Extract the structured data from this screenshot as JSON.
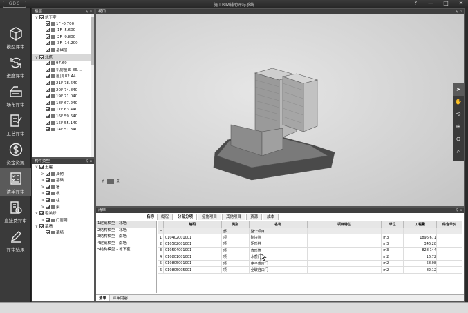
{
  "app": {
    "logo": "GDC",
    "title": "施工BIM辅助评标系统",
    "win_help": "?",
    "win_min": "—",
    "win_max": "□",
    "win_close": "✕"
  },
  "nav": [
    {
      "label": "模型评审",
      "icon": "cube-icon"
    },
    {
      "label": "进度评审",
      "icon": "progress-icon"
    },
    {
      "label": "场布评审",
      "icon": "site-layout-icon"
    },
    {
      "label": "工艺评审",
      "icon": "edit-doc-icon"
    },
    {
      "label": "资金资源",
      "icon": "dollar-icon"
    },
    {
      "label": "清单评审",
      "icon": "checklist-icon"
    },
    {
      "label": "直接费评审",
      "icon": "cost-doc-icon"
    },
    {
      "label": "评审结果",
      "icon": "pen-icon"
    }
  ],
  "floors_panel": {
    "title": "楼层",
    "items": [
      {
        "label": "地下室",
        "level": 0,
        "expand": "∨"
      },
      {
        "label": "1F -0.700",
        "level": 1
      },
      {
        "label": "-1F -5.600",
        "level": 1
      },
      {
        "label": "-2F -9.800",
        "level": 1
      },
      {
        "label": "-3F -14.200",
        "level": 1
      },
      {
        "label": "基础层",
        "level": 1
      },
      {
        "label": "北塔",
        "level": 0,
        "expand": "∨",
        "selected": true
      },
      {
        "label": "97.69",
        "level": 1
      },
      {
        "label": "机房屋面 86....",
        "level": 1
      },
      {
        "label": "屋顶 82.44",
        "level": 1
      },
      {
        "label": "21F 78.640",
        "level": 1
      },
      {
        "label": "20F 74.840",
        "level": 1
      },
      {
        "label": "19F 71.040",
        "level": 1
      },
      {
        "label": "18F 67.240",
        "level": 1
      },
      {
        "label": "17F 63.440",
        "level": 1
      },
      {
        "label": "16F 59.640",
        "level": 1
      },
      {
        "label": "15F 55.140",
        "level": 1
      },
      {
        "label": "14F 51.340",
        "level": 1
      }
    ]
  },
  "components_panel": {
    "title": "构件类型",
    "items": [
      {
        "label": "土建",
        "level": 0,
        "expand": "∨"
      },
      {
        "label": "其他",
        "level": 1,
        "expand": ">"
      },
      {
        "label": "基础",
        "level": 1,
        "expand": ">"
      },
      {
        "label": "墙",
        "level": 1,
        "expand": ">"
      },
      {
        "label": "板",
        "level": 1,
        "expand": ">"
      },
      {
        "label": "柱",
        "level": 1,
        "expand": ">"
      },
      {
        "label": "梁",
        "level": 1,
        "expand": ">"
      },
      {
        "label": "粗装修",
        "level": 0,
        "expand": "∨"
      },
      {
        "label": "门窗洞",
        "level": 1,
        "expand": ">"
      },
      {
        "label": "幕墙",
        "level": 0,
        "expand": "∨"
      },
      {
        "label": "幕墙",
        "level": 1,
        "expand": ""
      }
    ]
  },
  "viewport": {
    "title": "视口",
    "axis_y": "Y",
    "axis_x": "X"
  },
  "list_panel": {
    "title": "清单",
    "name_header": "名称",
    "tabs": [
      "概况",
      "分部分项",
      "措施项目",
      "其他项目",
      "资源",
      "成本"
    ],
    "active_tab": 1,
    "models": [
      "1建筑模型 - 北塔",
      "2结构模型 - 北塔",
      "3结构模型 - 南塔",
      "4建筑模型 - 南塔",
      "5结构模型 - 地下室"
    ],
    "columns": [
      "",
      "编码",
      "类别",
      "名称",
      "项目特征",
      "单位",
      "工程量",
      "综合单价"
    ],
    "rows": [
      {
        "idx": "",
        "code": "",
        "type": "部",
        "name": "整个项目",
        "feature": "",
        "unit": "",
        "qty": "",
        "price": "",
        "group": true,
        "toggle": "−"
      },
      {
        "idx": "1",
        "code": "010402001001",
        "type": "项",
        "name": "砌块墙",
        "feature": "",
        "unit": "m3",
        "qty": "1896.671",
        "price": ""
      },
      {
        "idx": "2",
        "code": "010502001001",
        "type": "项",
        "name": "矩形柱",
        "feature": "",
        "unit": "m3",
        "qty": "346.28",
        "price": ""
      },
      {
        "idx": "3",
        "code": "010504001001",
        "type": "项",
        "name": "直形墙",
        "feature": "",
        "unit": "m3",
        "qty": "828.144",
        "price": ""
      },
      {
        "idx": "4",
        "code": "010801001001",
        "type": "项",
        "name": "木质门",
        "feature": "",
        "unit": "m2",
        "qty": "16.72",
        "price": ""
      },
      {
        "idx": "5",
        "code": "010805001001",
        "type": "项",
        "name": "电子感应门",
        "feature": "",
        "unit": "m2",
        "qty": "58.08",
        "price": ""
      },
      {
        "idx": "6",
        "code": "010805005001",
        "type": "项",
        "name": "全玻自由门",
        "feature": "",
        "unit": "m2",
        "qty": "82.12",
        "price": ""
      }
    ],
    "bottom_tabs": [
      "清单",
      "评审内容"
    ]
  }
}
